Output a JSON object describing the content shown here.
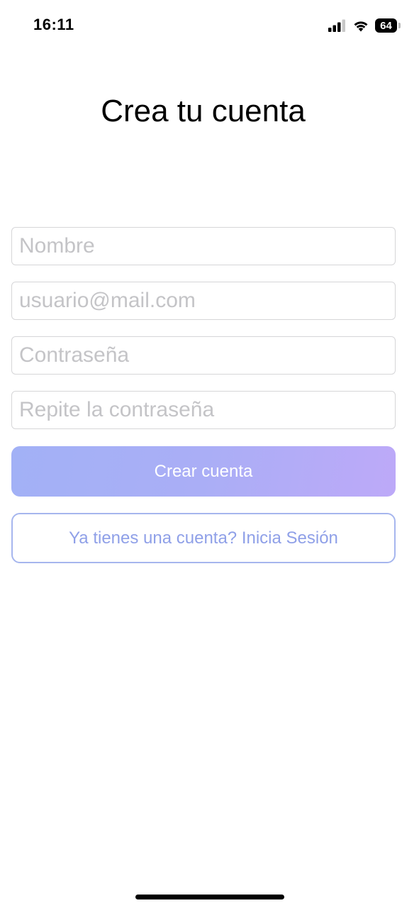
{
  "status_bar": {
    "time": "16:11",
    "battery_level": "64",
    "icons": [
      "signal-icon",
      "wifi-icon",
      "battery-icon"
    ]
  },
  "page": {
    "title": "Crea tu cuenta"
  },
  "form": {
    "name_placeholder": "Nombre",
    "email_placeholder": "usuario@mail.com",
    "password_placeholder": "Contraseña",
    "repeat_password_placeholder": "Repite la contraseña"
  },
  "actions": {
    "create_account_label": "Crear cuenta",
    "login_link_label": "Ya tienes una cuenta? Inicia Sesión"
  },
  "colors": {
    "primary_gradient_start": "#a2b1f6",
    "primary_gradient_end": "#bda9f8",
    "secondary_border": "#a6b6ee",
    "secondary_text": "#8fa0e8",
    "placeholder": "#c4c4c7"
  }
}
